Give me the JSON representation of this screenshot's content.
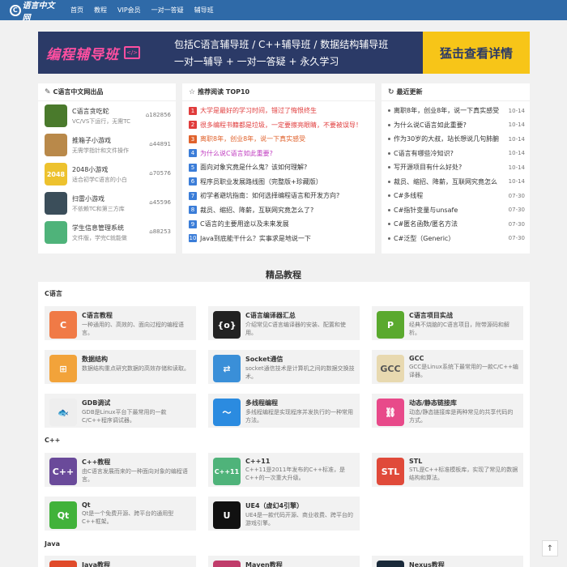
{
  "logo": {
    "mark": "C",
    "text": "语言中文网"
  },
  "nav": [
    "首页",
    "教程",
    "VIP会员",
    "一对一答疑",
    "辅导班"
  ],
  "banner": {
    "title": "编程辅导班",
    "code_icon": "</>",
    "line1": "包括C语言辅导班 / C++辅导班 / 数据结构辅导班",
    "line2": "一对一辅导 + 一对一答疑 + 永久学习",
    "button": "猛击查看详情"
  },
  "products": {
    "title": "C语言中文网出品",
    "items": [
      {
        "title": "C语言贪吃蛇",
        "desc": "VC/VS下运行，无需TC",
        "count": "182856",
        "icon": "snake-icon",
        "color": "#4a7a2c"
      },
      {
        "title": "推箱子小游戏",
        "desc": "无需学指针和文件操作",
        "count": "44891",
        "icon": "box-icon",
        "color": "#b9894a"
      },
      {
        "title": "2048小游戏",
        "desc": "适合初学C语言的小白",
        "count": "70576",
        "icon": "2048-icon",
        "label": "2048",
        "color": "#edc22e"
      },
      {
        "title": "扫雷小游戏",
        "desc": "不依赖TC和第三方库",
        "count": "45596",
        "icon": "mine-icon",
        "color": "#3b4e5a"
      },
      {
        "title": "学生信息管理系统",
        "desc": "文件版，学完C就能做",
        "count": "88253",
        "icon": "student-icon",
        "color": "#4fb37a"
      }
    ]
  },
  "top10": {
    "title": "推荐阅读 TOP10",
    "items": [
      {
        "n": "1",
        "text": "大学是最好的学习时间，错过了悔恨终生",
        "color": "#e03c3c",
        "ncolor": "#e03c3c"
      },
      {
        "n": "2",
        "text": "很多编程书籍都是垃圾，一定要擦亮眼睛，不要被误导！",
        "color": "#e03c3c",
        "ncolor": "#e03c3c"
      },
      {
        "n": "3",
        "text": "离职8年，创业8年，说一下真实感受",
        "color": "#e0622c",
        "ncolor": "#e0622c"
      },
      {
        "n": "4",
        "text": "为什么说C语言如此重要?",
        "color": "#c03cc0",
        "ncolor": "#3b7dd8"
      },
      {
        "n": "5",
        "text": "面向对象究竟是什么鬼？该如何理解?",
        "color": "#333333",
        "ncolor": "#3b7dd8"
      },
      {
        "n": "6",
        "text": "程序员职业发展路线图（完整版+珍藏版）",
        "color": "#333333",
        "ncolor": "#3b7dd8"
      },
      {
        "n": "7",
        "text": "初学者避坑指南：如何选择编程语言和开发方向?",
        "color": "#333333",
        "ncolor": "#3b7dd8"
      },
      {
        "n": "8",
        "text": "裁员、缩招、降薪，互联网究竟怎么了?",
        "color": "#333333",
        "ncolor": "#3b7dd8"
      },
      {
        "n": "9",
        "text": "C语言的主要用途以及未来发展",
        "color": "#333333",
        "ncolor": "#3b7dd8"
      },
      {
        "n": "10",
        "text": "Java到底能干什么？实事求是地说一下",
        "color": "#333333",
        "ncolor": "#3b7dd8"
      }
    ]
  },
  "updates": {
    "title": "最近更新",
    "items": [
      {
        "text": "离职8年，创业8年，说一下真实感受",
        "date": "10-14"
      },
      {
        "text": "为什么说C语言如此重要?",
        "date": "10-14"
      },
      {
        "text": "作为30岁的大叔，站长想说几句肺腑",
        "date": "10-14"
      },
      {
        "text": "C语言有哪些冷知识?",
        "date": "10-14"
      },
      {
        "text": "写开源项目有什么好处?",
        "date": "10-14"
      },
      {
        "text": "裁员、缩招、降薪，互联网究竟怎么",
        "date": "10-14"
      },
      {
        "text": "C#多线程",
        "date": "07-30"
      },
      {
        "text": "C#指针变量与unsafe",
        "date": "07-30"
      },
      {
        "text": "C#匿名函数/匿名方法",
        "date": "07-30"
      },
      {
        "text": "C#泛型（Generic）",
        "date": "07-30"
      }
    ]
  },
  "section_title": "精品教程",
  "categories": [
    {
      "label": "C语言",
      "cards": [
        {
          "title": "C语言教程",
          "desc": "一种通用的、高效的、面向过程的编程语言。",
          "icon": "c-lang-icon",
          "color": "#f07a46",
          "glyph": "C"
        },
        {
          "title": "C语言编译器汇总",
          "desc": "介绍常见C语言编译器的安装、配置和使用。",
          "icon": "compiler-icon",
          "color": "#222222",
          "glyph": "{o}"
        },
        {
          "title": "C语言项目实战",
          "desc": "经典不烧脑的C语言项目，附带源码和解析。",
          "icon": "project-icon",
          "color": "#5aa92e",
          "glyph": "P"
        },
        {
          "title": "数据结构",
          "desc": "数据结构重点研究数据的高效存储和读取。",
          "icon": "data-structure-icon",
          "color": "#f2a33a",
          "glyph": "⊞"
        },
        {
          "title": "Socket通信",
          "desc": "socket通信技术是计算机之间的数据交换技术。",
          "icon": "socket-icon",
          "color": "#3a8fd8",
          "glyph": "⇄"
        },
        {
          "title": "GCC",
          "desc": "GCC是Linux系统下最常用的一款C/C++编译器。",
          "icon": "gcc-icon",
          "color": "#e8d9b0",
          "glyph": "GCC"
        },
        {
          "title": "GDB调试",
          "desc": "GDB是Linux平台下最常用的一款C/C++程序调试器。",
          "icon": "gdb-icon",
          "color": "#eeeeee",
          "glyph": "🐟"
        },
        {
          "title": "多线程编程",
          "desc": "多线程编程是实现程序并发执行的一种常用方法。",
          "icon": "thread-icon",
          "color": "#2b8be0",
          "glyph": "〜"
        },
        {
          "title": "动态/静态链接库",
          "desc": "动态/静态链接库是两种常见的共享代码的方式。",
          "icon": "link-icon",
          "color": "#e84a8a",
          "glyph": "⛓"
        }
      ]
    },
    {
      "label": "C++",
      "cards": [
        {
          "title": "C++教程",
          "desc": "由C语言发展而来的一种面向对象的编程语言。",
          "icon": "cpp-icon",
          "color": "#6a4a9a",
          "glyph": "C++"
        },
        {
          "title": "C++11",
          "desc": "C++11是2011年发布的C++标准，是C++的一次重大升级。",
          "icon": "cpp11-icon",
          "color": "#4fb37a",
          "glyph": "C++11"
        },
        {
          "title": "STL",
          "desc": "STL是C++标准模板库，实现了常见的数据结构和算法。",
          "icon": "stl-icon",
          "color": "#e04a3a",
          "glyph": "STL"
        },
        {
          "title": "Qt",
          "desc": "Qt是一个免费开源、跨平台的通用型C++框架。",
          "icon": "qt-icon",
          "color": "#41b23a",
          "glyph": "Qt"
        },
        {
          "title": "UE4（虚幻4引擎）",
          "desc": "UE4是一款代码开源、商业收费、跨平台的游戏引擎。",
          "icon": "ue4-icon",
          "color": "#111111",
          "glyph": "U"
        }
      ]
    },
    {
      "label": "Java",
      "cards": [
        {
          "title": "Java教程",
          "desc": "",
          "icon": "java-icon",
          "color": "#e04a2a",
          "glyph": "J"
        },
        {
          "title": "Maven教程",
          "desc": "",
          "icon": "maven-icon",
          "color": "#c03c6a",
          "glyph": "M"
        },
        {
          "title": "Nexus教程",
          "desc": "",
          "icon": "nexus-icon",
          "color": "#1a2a3a",
          "glyph": "N"
        }
      ]
    }
  ],
  "to_top": "↑"
}
